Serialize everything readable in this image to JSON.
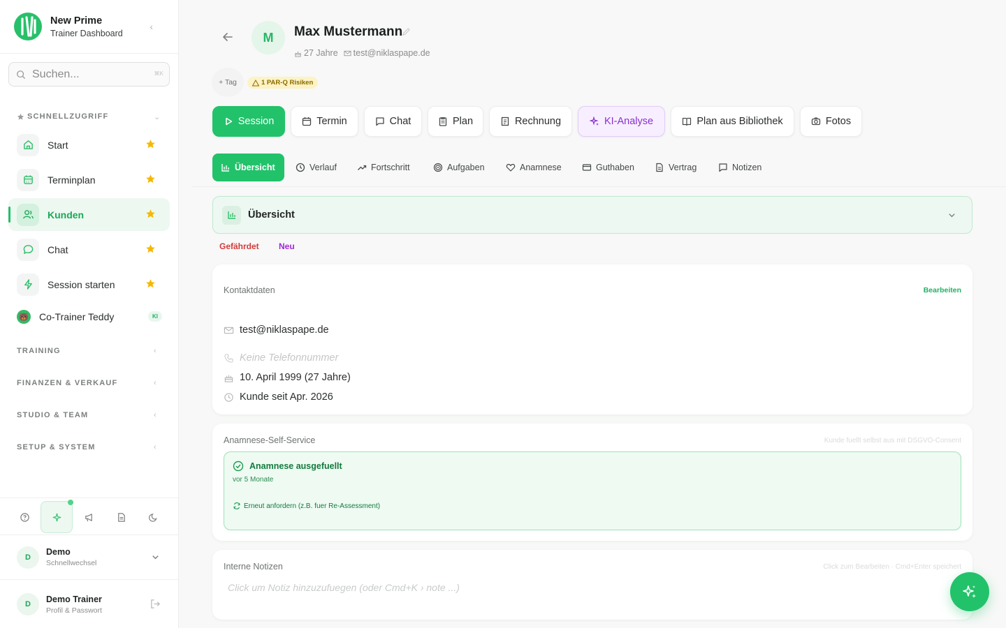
{
  "brand": {
    "title": "New Prime",
    "subtitle": "Trainer Dashboard"
  },
  "search": {
    "placeholder": "Suchen...",
    "shortcut": "⌘K"
  },
  "quick_access": {
    "heading": "SCHNELLZUGRIFF",
    "items": [
      {
        "label": "Start",
        "icon": "home-icon",
        "active": false
      },
      {
        "label": "Terminplan",
        "icon": "calendar-icon",
        "active": false
      },
      {
        "label": "Kunden",
        "icon": "users-icon",
        "active": true
      },
      {
        "label": "Chat",
        "icon": "chat-bubble-icon",
        "active": false
      },
      {
        "label": "Session starten",
        "icon": "lightning-icon",
        "active": false
      }
    ],
    "teddy": {
      "label": "Co-Trainer Teddy",
      "badge": "KI"
    }
  },
  "sections": [
    "TRAINING",
    "FINANZEN & VERKAUF",
    "STUDIO & TEAM",
    "SETUP & SYSTEM"
  ],
  "tools": [
    "help-icon",
    "sparkle-icon",
    "megaphone-icon",
    "document-icon",
    "moon-icon"
  ],
  "workspace": {
    "name": "Demo",
    "sub": "Schnellwechsel",
    "initial": "D"
  },
  "user": {
    "name": "Demo Trainer",
    "sub": "Profil & Passwort",
    "initial": "D"
  },
  "client": {
    "initial": "M",
    "name": "Max Mustermann",
    "age": "27 Jahre",
    "email": "test@niklaspape.de",
    "tag_button": "+ Tag",
    "risk_badge": "1 PAR-Q Risiken"
  },
  "actions": [
    "Session",
    "Termin",
    "Chat",
    "Plan",
    "Rechnung",
    "KI-Analyse",
    "Plan aus Bibliothek",
    "Fotos"
  ],
  "tabs": [
    "Übersicht",
    "Verlauf",
    "Fortschritt",
    "Aufgaben",
    "Anamnese",
    "Guthaben",
    "Vertrag",
    "Notizen"
  ],
  "overview": {
    "title": "Übersicht"
  },
  "status_tags": [
    {
      "label": "Gefährdet",
      "color": "#d63a3a"
    },
    {
      "label": "Neu",
      "color": "#a128d6"
    }
  ],
  "contact": {
    "title": "Kontaktdaten",
    "edit": "Bearbeiten",
    "email": "test@niklaspape.de",
    "phone": "Keine Telefonnummer",
    "birthday": "10. April 1999 (27 Jahre)",
    "since": "Kunde seit Apr. 2026"
  },
  "anamnesis": {
    "title": "Anamnese-Self-Service",
    "note": "Kunde fuellt selbst aus mit DSGVO-Consent",
    "status": "Anamnese ausgefuellt",
    "time": "vor 5 Monate",
    "link": "Erneut anfordern (z.B. fuer Re-Assessment)"
  },
  "notes": {
    "title": "Interne Notizen",
    "hint": "Click zum Bearbeiten · Cmd+Enter speichert",
    "placeholder": "Click um Notiz hinzuzufuegen (oder Cmd+K › note ...)"
  },
  "colors": {
    "accent": "#22c26a",
    "ai": "#8a2fd0",
    "star": "#f5b800"
  }
}
